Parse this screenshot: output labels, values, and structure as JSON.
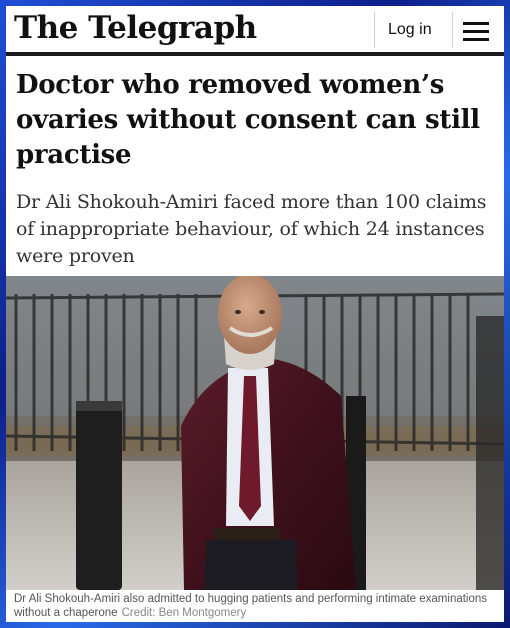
{
  "masthead": {
    "logo_text": "The Telegraph",
    "login_label": "Log in",
    "menu_icon": "hamburger-menu-icon"
  },
  "article": {
    "headline": "Doctor who removed women’s ovaries without consent can still practise",
    "standfirst": "Dr Ali Shokouh-Amiri faced more than 100 claims of inappropriate behaviour, of which 24 instances were proven",
    "caption": "Dr Ali Shokouh-Amiri also admitted to hugging patients and performing intimate examinations without a chaperone",
    "credit": "Credit: Ben Montgomery"
  },
  "colors": {
    "frame_blue": "#1f4fd6",
    "text_dark": "#111111",
    "jacket_burgundy": "#4a1522"
  }
}
